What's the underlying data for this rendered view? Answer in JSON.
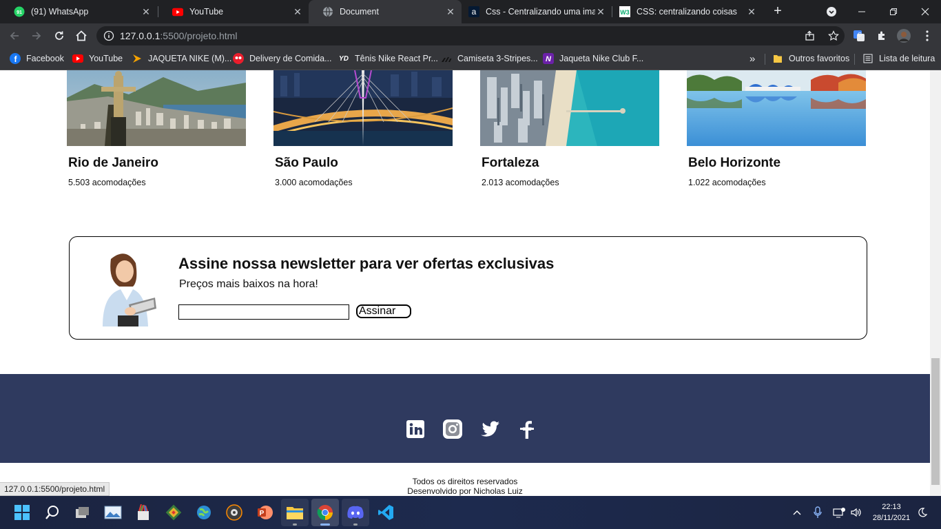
{
  "browser": {
    "tabs": [
      {
        "title": "(91) WhatsApp",
        "icon": "whatsapp-icon",
        "badge": "91",
        "active": false
      },
      {
        "title": "YouTube",
        "icon": "youtube-icon",
        "active": false
      },
      {
        "title": "Document",
        "icon": "globe-icon",
        "active": true
      },
      {
        "title": "Css - Centralizando uma imagem",
        "icon": "alura-icon",
        "active": false
      },
      {
        "title": "CSS: centralizando coisas",
        "icon": "w3-icon",
        "active": false
      }
    ],
    "url_host": "127.0.0.1",
    "url_path": ":5500/projeto.html",
    "bookmarks": [
      {
        "label": "Facebook",
        "icon": "facebook-icon"
      },
      {
        "label": "YouTube",
        "icon": "youtube-icon"
      },
      {
        "label": "JAQUETA NIKE (M)...",
        "icon": "arrow-icon"
      },
      {
        "label": "Delivery de Comida...",
        "icon": "ifood-icon"
      },
      {
        "label": "Tênis Nike React Pr...",
        "icon": "yd-icon"
      },
      {
        "label": "Camiseta 3-Stripes...",
        "icon": "adidas-icon"
      },
      {
        "label": "Jaqueta Nike Club F...",
        "icon": "netshoes-icon"
      }
    ],
    "bookmarks_overflow": "»",
    "other_favorites": "Outros favoritos",
    "reading_list": "Lista de leitura",
    "status_url": "127.0.0.1:5500/projeto.html"
  },
  "page": {
    "cities": [
      {
        "name": "Rio de Janeiro",
        "count": "5.503 acomodações"
      },
      {
        "name": "São Paulo",
        "count": "3.000 acomodações"
      },
      {
        "name": "Fortaleza",
        "count": "2.013 acomodações"
      },
      {
        "name": "Belo Horizonte",
        "count": "1.022 acomodações"
      }
    ],
    "newsletter": {
      "title": "Assine nossa newsletter para ver ofertas exclusivas",
      "subtitle": "Preços mais baixos na hora!",
      "input_value": "",
      "button_label": "Assinar"
    },
    "footer": {
      "social": [
        "linkedin-icon",
        "instagram-icon",
        "twitter-icon",
        "facebook-icon"
      ],
      "rights": "Todos os direitos reservados",
      "developer": "Desenvolvido por Nicholas Luiz"
    }
  },
  "taskbar": {
    "time": "22:13",
    "date": "28/11/2021"
  },
  "colors": {
    "footer_band": "#2f3a5f",
    "chrome_dark": "#202124",
    "chrome_toolbar": "#35363a"
  }
}
